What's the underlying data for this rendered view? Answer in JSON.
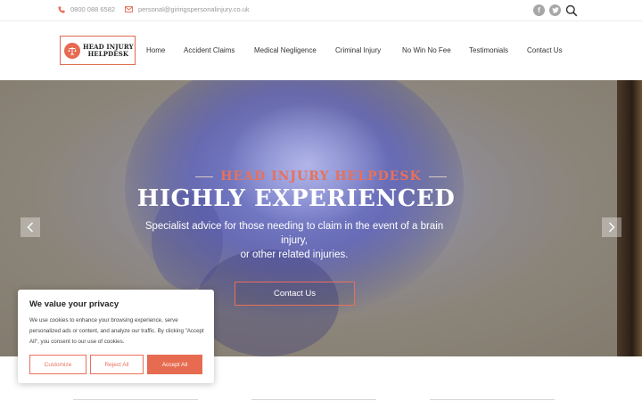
{
  "topbar": {
    "phone": "0800 088 6582",
    "email": "personal@giririgspersonalinjury.co.uk",
    "social": [
      {
        "icon": "facebook-icon",
        "glyph": "f"
      },
      {
        "icon": "twitter-icon",
        "glyph": "t"
      }
    ],
    "search_icon": "search-icon"
  },
  "header": {
    "logo_line1": "HEAD INJURY",
    "logo_line2": "HELPDESK",
    "nav": [
      "Home",
      "Accident Claims",
      "Medical Negligence",
      "Criminal Injury",
      "No Win No Fee",
      "Testimonials",
      "Contact Us"
    ]
  },
  "hero": {
    "kicker": "HEAD INJURY HELPDESK",
    "title": "HIGHLY EXPERIENCED",
    "subtitle_line1": "Specialist advice for those needing to claim in the event of a brain injury,",
    "subtitle_line2": "or other related injuries.",
    "cta": "Contact Us",
    "prev_icon": "chevron-left-icon",
    "next_icon": "chevron-right-icon"
  },
  "cookie": {
    "title": "We value your privacy",
    "text": "We use cookies to enhance your browsing experience, serve personalized ads or content, and analyze our traffic. By clicking \"Accept All\", you consent to our use of cookies.",
    "customize": "Customize",
    "reject": "Reject All",
    "accept": "Accept All"
  },
  "colors": {
    "accent": "#e66b50",
    "text_muted": "#9a9a9a",
    "social_bg": "#a7a7a7"
  }
}
